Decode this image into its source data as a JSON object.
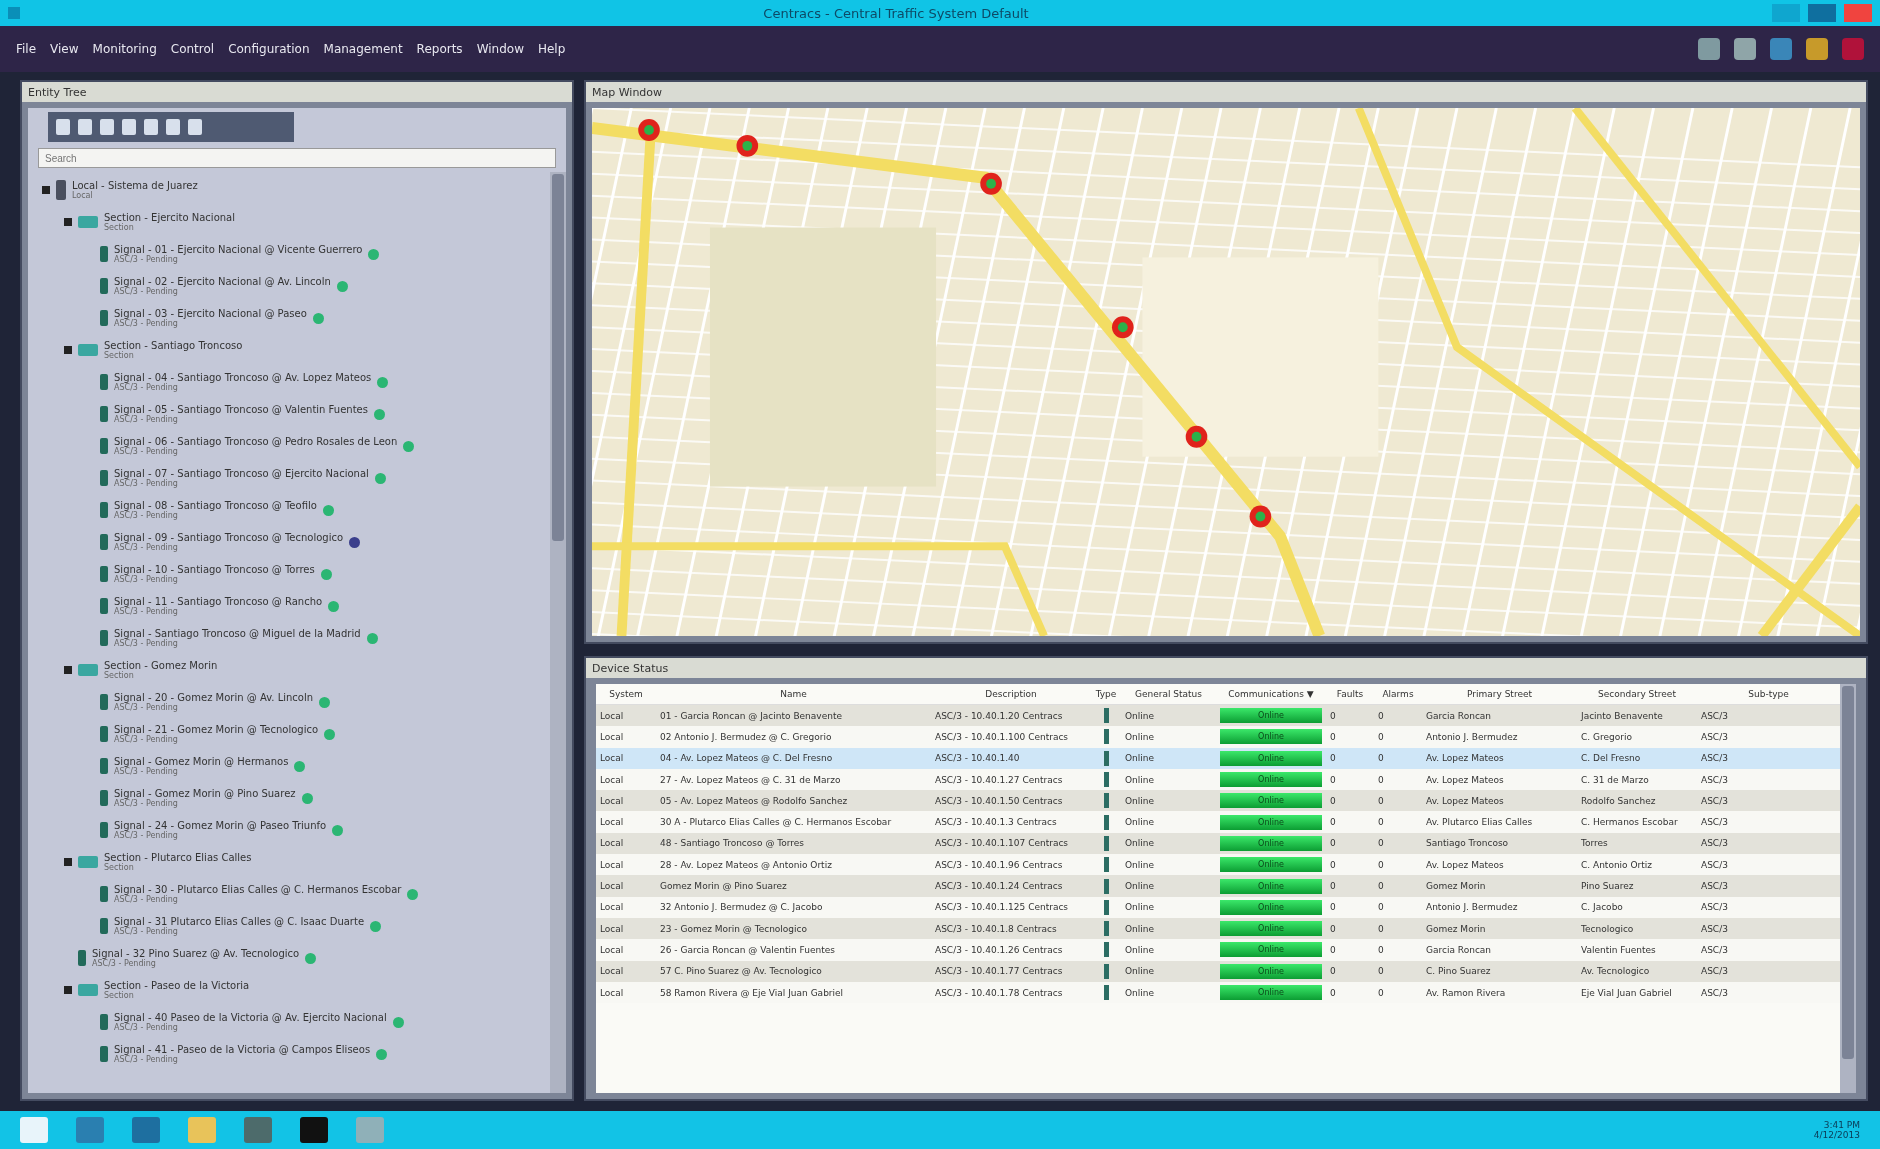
{
  "window": {
    "title": "Centracs - Central Traffic System Default"
  },
  "menu": [
    "File",
    "View",
    "Monitoring",
    "Control",
    "Configuration",
    "Management",
    "Reports",
    "Window",
    "Help"
  ],
  "entity_tree": {
    "title": "Entity Tree",
    "search": {
      "placeholder": "Search"
    },
    "items": [
      {
        "kind": "system",
        "label": "Local - Sistema de Juarez",
        "sub": "Local",
        "expanded": true,
        "children": [
          {
            "kind": "section",
            "label": "Section - Ejercito Nacional",
            "sub": "Section",
            "expanded": true,
            "children": [
              {
                "kind": "signal",
                "label": "Signal - 01 - Ejercito Nacional @ Vicente Guerrero",
                "sub": "ASC/3 - Pending",
                "color": "#2bb673"
              },
              {
                "kind": "signal",
                "label": "Signal - 02 - Ejercito Nacional @ Av. Lincoln",
                "sub": "ASC/3 - Pending",
                "color": "#2bb673"
              },
              {
                "kind": "signal",
                "label": "Signal - 03 - Ejercito Nacional @ Paseo",
                "sub": "ASC/3 - Pending",
                "color": "#2bb673"
              }
            ]
          },
          {
            "kind": "section",
            "label": "Section - Santiago Troncoso",
            "sub": "Section",
            "expanded": true,
            "children": [
              {
                "kind": "signal",
                "label": "Signal - 04 - Santiago Troncoso @ Av. Lopez Mateos",
                "sub": "ASC/3 - Pending",
                "color": "#2bb673"
              },
              {
                "kind": "signal",
                "label": "Signal - 05 - Santiago Troncoso @ Valentin Fuentes",
                "sub": "ASC/3 - Pending",
                "color": "#2bb673"
              },
              {
                "kind": "signal",
                "label": "Signal - 06 - Santiago Troncoso @ Pedro Rosales de Leon",
                "sub": "ASC/3 - Pending",
                "color": "#2bb673"
              },
              {
                "kind": "signal",
                "label": "Signal - 07 - Santiago Troncoso @ Ejercito Nacional",
                "sub": "ASC/3 - Pending",
                "color": "#2bb673"
              },
              {
                "kind": "signal",
                "label": "Signal - 08 - Santiago Troncoso @ Teofilo",
                "sub": "ASC/3 - Pending",
                "color": "#2bb673"
              },
              {
                "kind": "signal",
                "label": "Signal - 09 - Santiago Troncoso @ Tecnologico",
                "sub": "ASC/3 - Pending",
                "color": "#3b3f8c"
              },
              {
                "kind": "signal",
                "label": "Signal - 10 - Santiago Troncoso @ Torres",
                "sub": "ASC/3 - Pending",
                "color": "#2bb673"
              },
              {
                "kind": "signal",
                "label": "Signal - 11 - Santiago Troncoso @ Rancho",
                "sub": "ASC/3 - Pending",
                "color": "#2bb673"
              },
              {
                "kind": "signal",
                "label": "Signal - Santiago Troncoso @ Miguel de la Madrid",
                "sub": "ASC/3 - Pending",
                "color": "#2bb673"
              }
            ]
          },
          {
            "kind": "section",
            "label": "Section - Gomez Morin",
            "sub": "Section",
            "expanded": true,
            "children": [
              {
                "kind": "signal",
                "label": "Signal - 20 - Gomez Morin @ Av. Lincoln",
                "sub": "ASC/3 - Pending",
                "color": "#2bb673"
              },
              {
                "kind": "signal",
                "label": "Signal - 21 - Gomez Morin @ Tecnologico",
                "sub": "ASC/3 - Pending",
                "color": "#2bb673"
              },
              {
                "kind": "signal",
                "label": "Signal - Gomez Morin @ Hermanos",
                "sub": "ASC/3 - Pending",
                "color": "#2bb673"
              },
              {
                "kind": "signal",
                "label": "Signal - Gomez Morin @ Pino Suarez",
                "sub": "ASC/3 - Pending",
                "color": "#2bb673"
              },
              {
                "kind": "signal",
                "label": "Signal - 24 - Gomez Morin @ Paseo Triunfo",
                "sub": "ASC/3 - Pending",
                "color": "#2bb673"
              }
            ]
          },
          {
            "kind": "section",
            "label": "Section - Plutarco Elias Calles",
            "sub": "Section",
            "expanded": true,
            "children": [
              {
                "kind": "signal",
                "label": "Signal - 30 - Plutarco Elias Calles @ C. Hermanos Escobar",
                "sub": "ASC/3 - Pending",
                "color": "#2bb673"
              },
              {
                "kind": "signal",
                "label": "Signal - 31 Plutarco Elias Calles @ C. Isaac Duarte",
                "sub": "ASC/3 - Pending",
                "color": "#2bb673"
              }
            ]
          },
          {
            "kind": "signal",
            "label": "Signal - 32 Pino Suarez @ Av. Tecnologico",
            "sub": "ASC/3 - Pending",
            "color": "#2bb673"
          },
          {
            "kind": "section",
            "label": "Section - Paseo de la Victoria",
            "sub": "Section",
            "expanded": true,
            "children": [
              {
                "kind": "signal",
                "label": "Signal - 40 Paseo de la Victoria @ Av. Ejercito Nacional",
                "sub": "ASC/3 - Pending",
                "color": "#2bb673"
              },
              {
                "kind": "signal",
                "label": "Signal - 41 - Paseo de la Victoria @ Campos Eliseos",
                "sub": "ASC/3 - Pending",
                "color": "#2bb673"
              }
            ]
          }
        ]
      }
    ]
  },
  "map": {
    "title": "Map Window"
  },
  "device_status": {
    "title": "Device Status",
    "columns": [
      "System",
      "Name",
      "Description",
      "Type",
      "General Status",
      "Communications ▼",
      "Faults",
      "Alarms",
      "Primary Street",
      "Secondary Street",
      "Sub-type"
    ],
    "rows": [
      {
        "selected": false,
        "cells": [
          "Local",
          "01 - Garcia Roncan @ Jacinto Benavente",
          "ASC/3 - 10.40.1.20 Centracs",
          "",
          "Online",
          "Online",
          "0",
          "0",
          "Garcia Roncan",
          "Jacinto Benavente",
          "ASC/3"
        ]
      },
      {
        "selected": false,
        "cells": [
          "Local",
          "02 Antonio J. Bermudez @ C. Gregorio",
          "ASC/3 - 10.40.1.100 Centracs",
          "",
          "Online",
          "Online",
          "0",
          "0",
          "Antonio J. Bermudez",
          "C. Gregorio",
          "ASC/3"
        ]
      },
      {
        "selected": true,
        "cells": [
          "Local",
          "04 - Av. Lopez Mateos @ C. Del Fresno",
          "ASC/3 - 10.40.1.40",
          "",
          "Online",
          "Online",
          "0",
          "0",
          "Av. Lopez Mateos",
          "C. Del Fresno",
          "ASC/3"
        ]
      },
      {
        "selected": false,
        "cells": [
          "Local",
          "27 - Av. Lopez Mateos @ C. 31 de Marzo",
          "ASC/3 - 10.40.1.27 Centracs",
          "",
          "Online",
          "Online",
          "0",
          "0",
          "Av. Lopez Mateos",
          "C. 31 de Marzo",
          "ASC/3"
        ]
      },
      {
        "selected": false,
        "cells": [
          "Local",
          "05 - Av. Lopez Mateos @ Rodolfo Sanchez",
          "ASC/3 - 10.40.1.50 Centracs",
          "",
          "Online",
          "Online",
          "0",
          "0",
          "Av. Lopez Mateos",
          "Rodolfo Sanchez",
          "ASC/3"
        ]
      },
      {
        "selected": false,
        "cells": [
          "Local",
          "30 A - Plutarco Elias Calles @ C. Hermanos Escobar",
          "ASC/3 - 10.40.1.3 Centracs",
          "",
          "Online",
          "Online",
          "0",
          "0",
          "Av. Plutarco Elias Calles",
          "C. Hermanos Escobar",
          "ASC/3"
        ]
      },
      {
        "selected": false,
        "cells": [
          "Local",
          "48 - Santiago Troncoso @ Torres",
          "ASC/3 - 10.40.1.107 Centracs",
          "",
          "Online",
          "Online",
          "0",
          "0",
          "Santiago Troncoso",
          "Torres",
          "ASC/3"
        ]
      },
      {
        "selected": false,
        "cells": [
          "Local",
          "28 - Av. Lopez Mateos @ Antonio Ortiz",
          "ASC/3 - 10.40.1.96 Centracs",
          "",
          "Online",
          "Online",
          "0",
          "0",
          "Av. Lopez Mateos",
          "C. Antonio Ortiz",
          "ASC/3"
        ]
      },
      {
        "selected": false,
        "cells": [
          "Local",
          "Gomez Morin @ Pino Suarez",
          "ASC/3 - 10.40.1.24 Centracs",
          "",
          "Online",
          "Online",
          "0",
          "0",
          "Gomez Morin",
          "Pino Suarez",
          "ASC/3"
        ]
      },
      {
        "selected": false,
        "cells": [
          "Local",
          "32 Antonio J. Bermudez @ C. Jacobo",
          "ASC/3 - 10.40.1.125 Centracs",
          "",
          "Online",
          "Online",
          "0",
          "0",
          "Antonio J. Bermudez",
          "C. Jacobo",
          "ASC/3"
        ]
      },
      {
        "selected": false,
        "cells": [
          "Local",
          "23 - Gomez Morin @ Tecnologico",
          "ASC/3 - 10.40.1.8 Centracs",
          "",
          "Online",
          "Online",
          "0",
          "0",
          "Gomez Morin",
          "Tecnologico",
          "ASC/3"
        ]
      },
      {
        "selected": false,
        "cells": [
          "Local",
          "26 - Garcia Roncan @ Valentin Fuentes",
          "ASC/3 - 10.40.1.26 Centracs",
          "",
          "Online",
          "Online",
          "0",
          "0",
          "Garcia Roncan",
          "Valentin Fuentes",
          "ASC/3"
        ]
      },
      {
        "selected": false,
        "cells": [
          "Local",
          "57 C. Pino Suarez @ Av. Tecnologico",
          "ASC/3 - 10.40.1.77 Centracs",
          "",
          "Online",
          "Online",
          "0",
          "0",
          "C. Pino Suarez",
          "Av. Tecnologico",
          "ASC/3"
        ]
      },
      {
        "selected": false,
        "cells": [
          "Local",
          "58 Ramon Rivera @ Eje Vial Juan Gabriel",
          "ASC/3 - 10.40.1.78 Centracs",
          "",
          "Online",
          "Online",
          "0",
          "0",
          "Av. Ramon Rivera",
          "Eje Vial Juan Gabriel",
          "ASC/3"
        ]
      }
    ]
  },
  "taskbar": {
    "time": "3:41 PM",
    "date": "4/12/2013"
  }
}
